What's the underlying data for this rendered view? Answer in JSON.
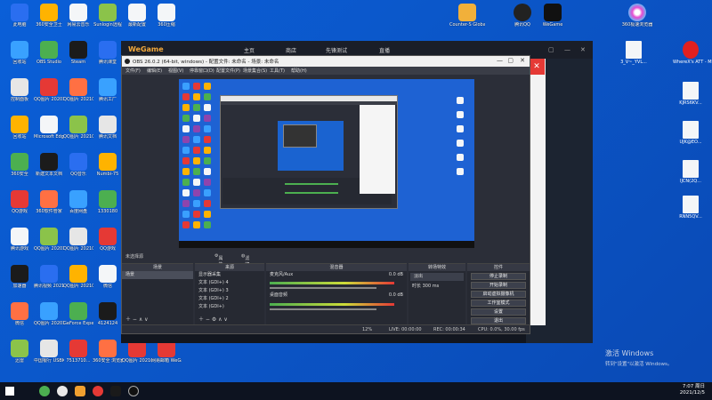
{
  "desktop": {
    "col1": [
      "此电脑",
      "回收站",
      "控制面板",
      "回收站",
      "360安全",
      "QQ游戏",
      "腾讯游戏",
      "加速器",
      "微信",
      "迅雷"
    ],
    "col2": [
      "360安全卫士",
      "OBS Studio",
      "QQ图片 2020112...",
      "Microsoft Edge",
      "新建文本文档",
      "360软件管家",
      "QQ图片 2020112...",
      "腾讯视频 2021...",
      "QQ图片 2020120...",
      "中国银行 USBKey..."
    ],
    "col3": [
      "网易云音乐",
      "Steam",
      "QQ图片 2021012...",
      "QQ图片 2021012...",
      "QQ音乐",
      "百度网盘",
      "QQ图片 2021040...",
      "QQ图片 2021040...",
      "GeForce Experience",
      "7513710..."
    ],
    "col4": [
      "Sunlogin远程",
      "腾讯课堂",
      "腾讯工厂",
      "腾讯文档",
      "Numbi-75",
      "1330180",
      "QQ游戏",
      "微信",
      "4124124",
      "360安全 浏览器"
    ],
    "col5": [
      "最新配置",
      "Ho-5",
      "",
      "",
      "",
      "",
      "",
      "",
      "",
      "QQ图片 2021019..."
    ],
    "col6": [
      "360压缩",
      "",
      "",
      "",
      "",
      "",
      "",
      "",
      "",
      "网易邮箱 WeGame网易"
    ],
    "top_right": [
      "Counter-S Global Off...",
      "腾讯QQ",
      "WeGame",
      "360极速浏览器"
    ],
    "right_col": [
      "3_V~_YVL...",
      "WhereX's ATT - Mid...",
      "KJRS6KV...",
      "UJK@EO...",
      "IJCN(2Q...",
      "RNN5QV..."
    ]
  },
  "wegame": {
    "logo": "WeGame",
    "tabs": [
      "主页",
      "商店",
      "先锋测试",
      "直播"
    ],
    "controls": [
      "▢",
      "—",
      "✕"
    ]
  },
  "obs": {
    "title": "OBS 26.0.2 (64-bit, windows) - 配置文件: 未命名 - 场景: 未命名",
    "menus": [
      "文件(F)",
      "编辑(E)",
      "视图(V)",
      "停靠窗口(D)",
      "配置文件(P)",
      "场景集合(S)",
      "工具(T)",
      "帮助(H)"
    ],
    "source_label": "未选择源",
    "props_btn": "属性",
    "filter_btn": "滤镜",
    "docks": {
      "scenes": {
        "title": "场景",
        "items": [
          "场景"
        ]
      },
      "sources": {
        "title": "来源",
        "items": [
          "显示器采集",
          "文本 (GDI+) 4",
          "文本 (GDI+) 3",
          "文本 (GDI+) 2",
          "文本 (GDI+)"
        ]
      },
      "mixer": {
        "title": "混音器",
        "tracks": [
          {
            "name": "麦克风/Aux",
            "db": "0.0 dB"
          },
          {
            "name": "桌面音频",
            "db": "0.0 dB"
          }
        ]
      },
      "transitions": {
        "title": "转场特效",
        "type": "淡出",
        "duration_label": "时长",
        "duration": "300 ms"
      },
      "controls": {
        "title": "控件",
        "buttons": [
          "停止录制",
          "开始录制",
          "启动虚拟摄像机",
          "工作室模式",
          "设置",
          "退出"
        ]
      }
    },
    "status": [
      "LIVE: 00:00:00",
      "REC: 00:00:34",
      "CPU: 0.0%, 30.00 fps"
    ],
    "drop": "12%"
  },
  "watermark": {
    "line1": "激活 Windows",
    "line2": "转到\"设置\"以激活 Windows。"
  },
  "taskbar": {
    "time": "7:07 周日",
    "date": "2021/12/5"
  }
}
